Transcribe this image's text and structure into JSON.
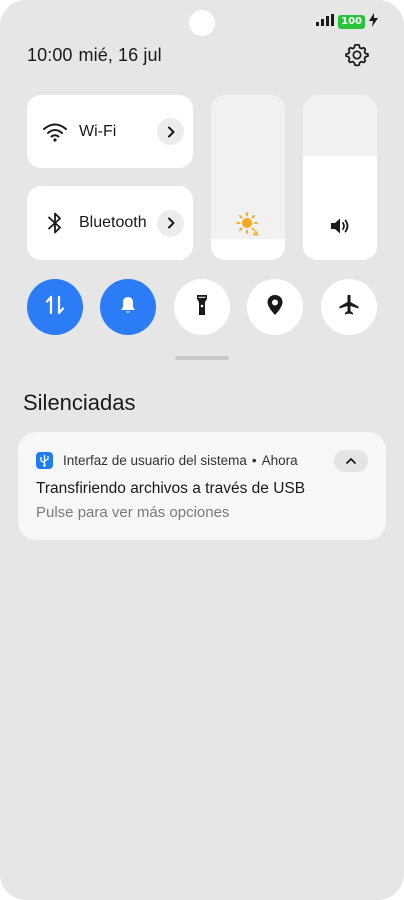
{
  "status_bar": {
    "battery_level": "100",
    "signal_icon": "signal-bars-icon",
    "charging_icon": "charging-bolt-icon"
  },
  "header": {
    "time": "10:00",
    "date": "mié, 16 jul",
    "settings_icon": "gear-icon"
  },
  "quick_tiles": {
    "wifi": {
      "label": "Wi-Fi",
      "icon": "wifi-icon"
    },
    "bluetooth": {
      "label": "Bluetooth",
      "icon": "bluetooth-icon"
    }
  },
  "sliders": {
    "brightness": {
      "icon": "auto-brightness-icon",
      "level": 0.13
    },
    "volume": {
      "icon": "volume-icon",
      "level": 0.63
    }
  },
  "toggles": [
    {
      "name": "mobile-data",
      "icon": "data-transfer-icon",
      "on": true
    },
    {
      "name": "sound",
      "icon": "bell-icon",
      "on": true
    },
    {
      "name": "flashlight",
      "icon": "flashlight-icon",
      "on": false
    },
    {
      "name": "location",
      "icon": "location-pin-icon",
      "on": false
    },
    {
      "name": "airplane-mode",
      "icon": "airplane-icon",
      "on": false
    }
  ],
  "colors": {
    "accent": "#2b7cf6",
    "battery": "#27c23a",
    "sun": "#f2a81d"
  },
  "silenced": {
    "title": "Silenciadas",
    "notification": {
      "app": "Interfaz de usuario del sistema",
      "separator": "•",
      "time": "Ahora",
      "title": "Transfiriendo archivos a través de USB",
      "text": "Pulse para ver más opciones",
      "icon": "usb-icon"
    }
  }
}
